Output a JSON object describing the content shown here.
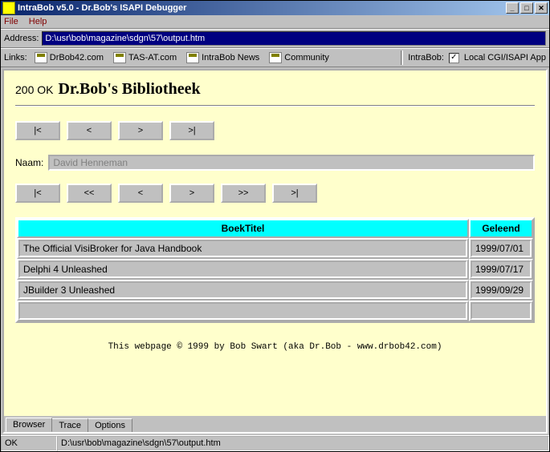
{
  "window": {
    "title": "IntraBob v5.0 - Dr.Bob's ISAPI Debugger"
  },
  "menu": {
    "file": "File",
    "help": "Help"
  },
  "address": {
    "label": "Address:",
    "value": "D:\\usr\\bob\\magazine\\sdgn\\57\\output.htm"
  },
  "links": {
    "label": "Links:",
    "items": [
      "DrBob42.com",
      "TAS-AT.com",
      "IntraBob News",
      "Community"
    ],
    "intrabob_label": "IntraBob:",
    "checkbox_checked": "✓",
    "checkbox_label": "Local CGI/ISAPI App"
  },
  "page": {
    "status": "200 OK",
    "title": "Dr.Bob's Bibliotheek",
    "nav1": [
      "|<",
      "<",
      ">",
      ">|"
    ],
    "naam_label": "Naam:",
    "naam_value": "David Henneman",
    "nav2": [
      "|<",
      "<<",
      "<",
      ">",
      ">>",
      ">|"
    ],
    "table": {
      "headers": [
        "BoekTitel",
        "Geleend"
      ],
      "rows": [
        {
          "title": "The Official VisiBroker for Java Handbook",
          "date": "1999/07/01"
        },
        {
          "title": "Delphi 4 Unleashed",
          "date": "1999/07/17"
        },
        {
          "title": "JBuilder 3 Unleashed",
          "date": "1999/09/29"
        },
        {
          "title": "",
          "date": ""
        }
      ]
    },
    "footer": "This webpage © 1999 by Bob Swart (aka Dr.Bob - www.drbob42.com)"
  },
  "tabs": [
    "Browser",
    "Trace",
    "Options"
  ],
  "status": {
    "ok": "OK",
    "path": "D:\\usr\\bob\\magazine\\sdgn\\57\\output.htm"
  }
}
